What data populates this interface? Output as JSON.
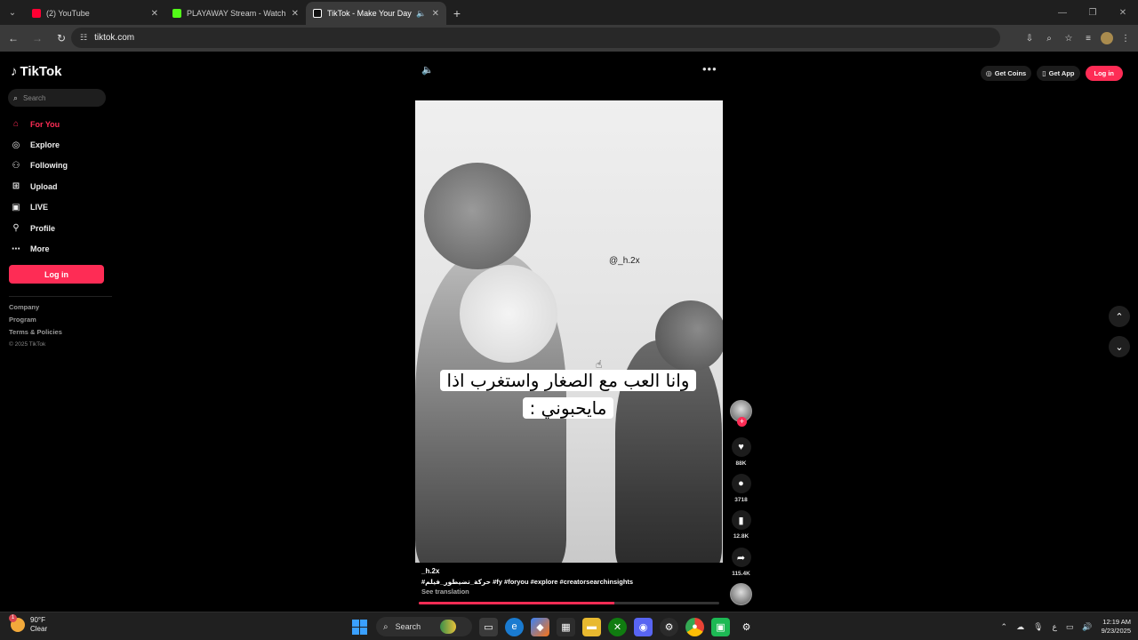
{
  "browser": {
    "tabs": [
      {
        "title": "(2) YouTube",
        "color": "#ff0033",
        "active": false
      },
      {
        "title": "PLAYAWAY Stream - Watch Live",
        "color": "#53fc18",
        "active": false
      },
      {
        "title": "TikTok - Make Your Day",
        "color": "#ffffff",
        "active": true
      }
    ],
    "url": "tiktok.com"
  },
  "tiktok": {
    "logo": "TikTok",
    "search_placeholder": "Search",
    "nav": [
      {
        "label": "For You",
        "icon": "home-icon",
        "active": true
      },
      {
        "label": "Explore",
        "icon": "compass-icon"
      },
      {
        "label": "Following",
        "icon": "following-icon"
      },
      {
        "label": "Upload",
        "icon": "upload-icon"
      },
      {
        "label": "LIVE",
        "icon": "live-icon"
      },
      {
        "label": "Profile",
        "icon": "profile-icon"
      },
      {
        "label": "More",
        "icon": "more-icon"
      }
    ],
    "login_label": "Log in",
    "footer": [
      "Company",
      "Program",
      "Terms & Policies"
    ],
    "copyright": "© 2025 TikTok",
    "top_actions": {
      "coins": "Get Coins",
      "app": "Get App",
      "login": "Log in"
    },
    "accent": "#fe2c55"
  },
  "video": {
    "watermark_handle": "@_h.2x",
    "caption_arabic": "وانا العب مع الصغار واستغرب اذا مايحبوني :",
    "author": "_h.2x",
    "description": "#حركة_تضيطور_فيلم #fy #foryou #explore #creatorsearchinsights",
    "see_translation": "See translation",
    "progress": 0.65,
    "likes": "88K",
    "comments": "3718",
    "saves": "12.8K",
    "shares": "115.4K"
  },
  "taskbar": {
    "temperature": "90°F",
    "condition": "Clear",
    "weather_badge": "1",
    "search_label": "Search",
    "time": "12:19 AM",
    "date": "9/23/2025"
  }
}
